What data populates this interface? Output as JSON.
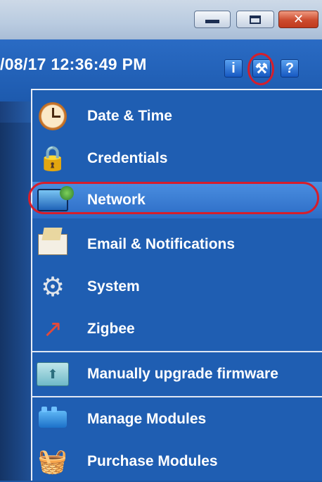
{
  "window": {
    "minimize_glyph": "",
    "close_glyph": "✕"
  },
  "header": {
    "datetime": "/08/17 12:36:49 PM",
    "info_icon": "i",
    "tools_icon": "⚒",
    "help_icon": "?"
  },
  "menu": {
    "items": [
      {
        "label": "Date & Time",
        "icon": "clock-icon"
      },
      {
        "label": "Credentials",
        "icon": "lock-icon"
      },
      {
        "label": "Network",
        "icon": "network-icon"
      },
      {
        "label": "Email & Notifications",
        "icon": "envelope-icon"
      },
      {
        "label": "System",
        "icon": "gear-icon"
      },
      {
        "label": "Zigbee",
        "icon": "zigbee-icon"
      },
      {
        "label": "Manually upgrade firmware",
        "icon": "upgrade-icon"
      },
      {
        "label": "Manage Modules",
        "icon": "modules-icon"
      },
      {
        "label": "Purchase Modules",
        "icon": "basket-icon"
      }
    ],
    "selected_index": 2
  },
  "colors": {
    "accent": "#1f5eb2",
    "highlight": "#d61e2b"
  }
}
